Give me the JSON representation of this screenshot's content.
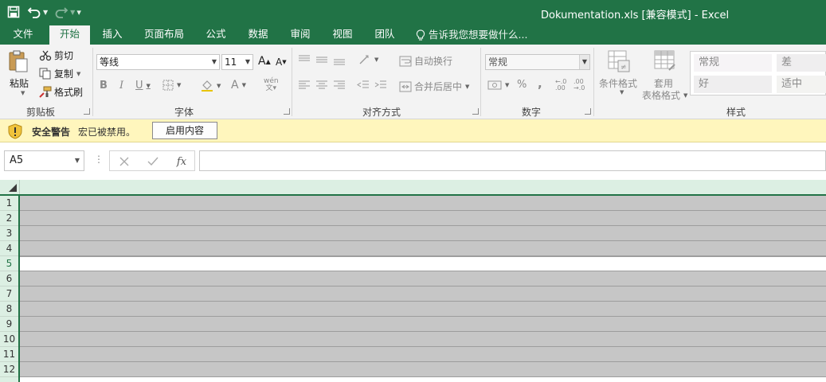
{
  "window": {
    "title": "Dokumentation.xls  [兼容模式] - Excel"
  },
  "qat": {
    "save": "save-icon",
    "undo": "undo-icon",
    "redo": "redo-icon",
    "customize": "▾"
  },
  "tabs": [
    {
      "label": "文件",
      "active": false
    },
    {
      "label": "开始",
      "active": true
    },
    {
      "label": "插入",
      "active": false
    },
    {
      "label": "页面布局",
      "active": false
    },
    {
      "label": "公式",
      "active": false
    },
    {
      "label": "数据",
      "active": false
    },
    {
      "label": "审阅",
      "active": false
    },
    {
      "label": "视图",
      "active": false
    },
    {
      "label": "团队",
      "active": false
    }
  ],
  "tell_me": "告诉我您想要做什么...",
  "ribbon": {
    "clipboard": {
      "paste": "粘贴",
      "cut": "剪切",
      "copy": "复制",
      "format_painter": "格式刷",
      "group": "剪贴板"
    },
    "font": {
      "name": "等线",
      "size": "11",
      "bold": "B",
      "italic": "I",
      "underline": "U",
      "grow": "A",
      "shrink": "A",
      "font_color": "A",
      "phonetic": "wén",
      "group": "字体"
    },
    "alignment": {
      "wrap": "自动换行",
      "merge": "合并后居中",
      "group": "对齐方式"
    },
    "number": {
      "format": "常规",
      "percent": "%",
      "comma": ",",
      "inc_decimal": "←.0 .00",
      "dec_decimal": ".00 →.0",
      "group": "数字"
    },
    "styles": {
      "conditional": "条件格式",
      "table_l1": "套用",
      "table_l2": "表格格式",
      "cells": [
        "常规",
        "差",
        "好",
        "适中"
      ],
      "group": "样式"
    }
  },
  "security": {
    "title": "安全警告",
    "message": "宏已被禁用。",
    "button": "启用内容"
  },
  "formula_bar": {
    "name_box": "A5",
    "fx": "fx",
    "value": ""
  },
  "grid": {
    "rows": [
      "1",
      "2",
      "3",
      "4",
      "5",
      "6",
      "7",
      "8",
      "9",
      "10",
      "11",
      "12"
    ],
    "selected_row": "5"
  },
  "colors": {
    "accent": "#217346",
    "header_bg": "#dcefe3",
    "cell_gray": "#c6c6c6",
    "warning_bg": "#fff6bd"
  }
}
